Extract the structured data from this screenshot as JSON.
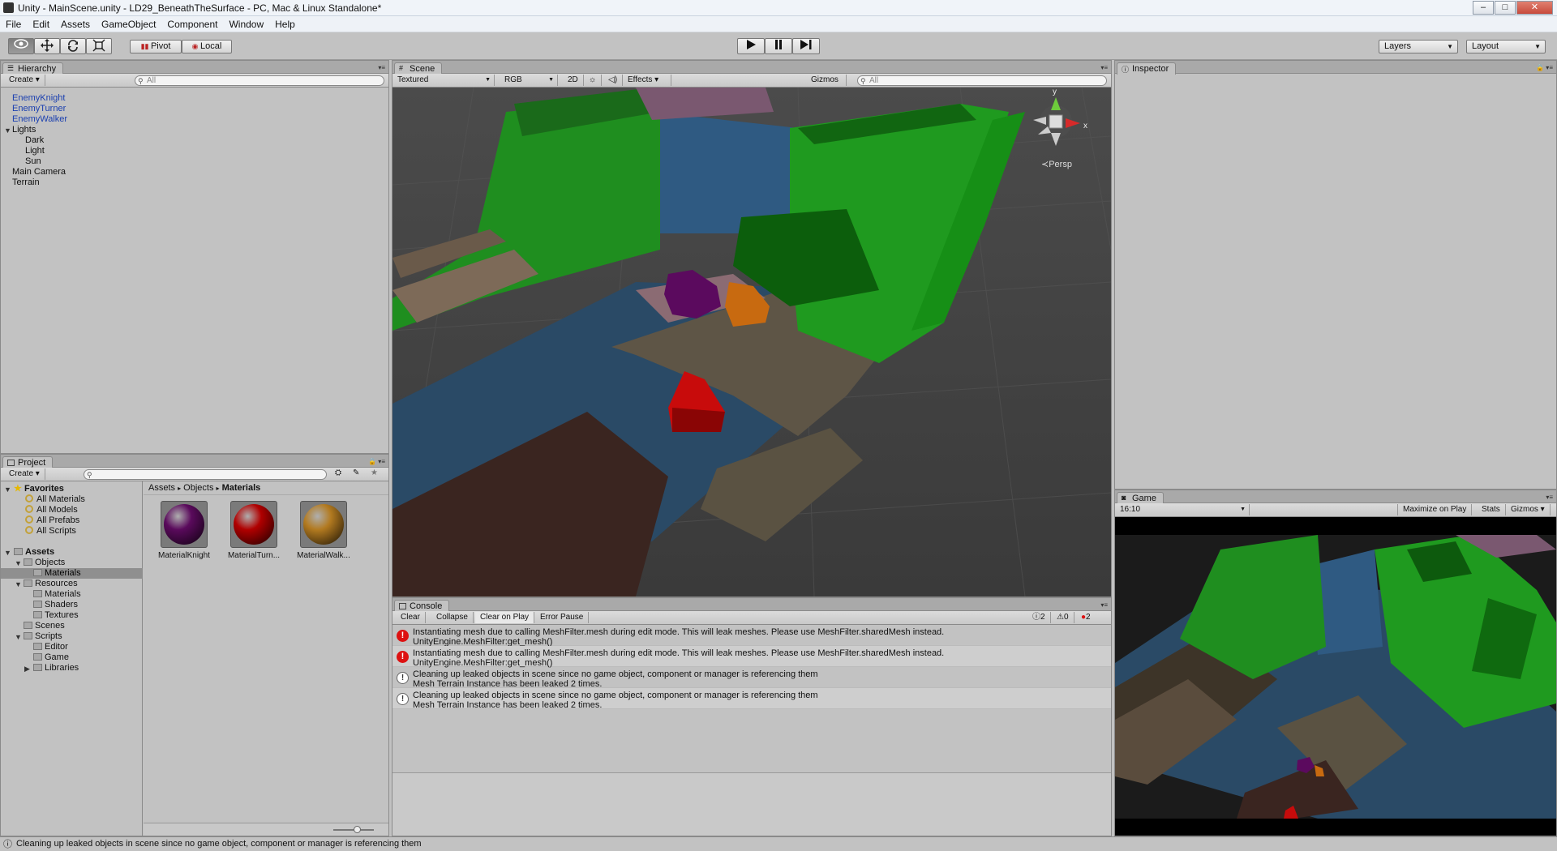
{
  "window": {
    "title": "Unity - MainScene.unity - LD29_BeneathTheSurface - PC, Mac & Linux Standalone*",
    "minimize": "–",
    "maximize": "□",
    "close": "✕",
    "close_color": "#c74b3c"
  },
  "menu": [
    "File",
    "Edit",
    "Assets",
    "GameObject",
    "Component",
    "Window",
    "Help"
  ],
  "toolbar": {
    "tools": [
      "hand-icon",
      "move-icon",
      "rotate-icon",
      "scale-icon"
    ],
    "pivot_label": "Pivot",
    "local_label": "Local",
    "play_icon": "play-icon",
    "pause_icon": "pause-icon",
    "step_icon": "step-icon",
    "layers_label": "Layers",
    "layout_label": "Layout"
  },
  "hierarchy": {
    "tab": "Hierarchy",
    "create_label": "Create",
    "search_placeholder": "All",
    "items": [
      {
        "label": "EnemyKnight",
        "indent": 0,
        "prefab": true
      },
      {
        "label": "EnemyTurner",
        "indent": 0,
        "prefab": true
      },
      {
        "label": "EnemyWalker",
        "indent": 0,
        "prefab": true
      },
      {
        "label": "Lights",
        "indent": 0,
        "expanded": true
      },
      {
        "label": "Dark",
        "indent": 1
      },
      {
        "label": "Light",
        "indent": 1
      },
      {
        "label": "Sun",
        "indent": 1
      },
      {
        "label": "Main Camera",
        "indent": 0
      },
      {
        "label": "Terrain",
        "indent": 0
      }
    ]
  },
  "scene": {
    "tab": "Scene",
    "shading": "Textured",
    "render_mode": "RGB",
    "mode_2d": "2D",
    "effects_label": "Effects",
    "gizmos_label": "Gizmos",
    "search_placeholder": "All",
    "gizmo_y": "y",
    "gizmo_x": "x",
    "persp_label": "Persp"
  },
  "inspector": {
    "tab": "Inspector"
  },
  "project": {
    "tab": "Project",
    "create_label": "Create",
    "breadcrumb": [
      "Assets",
      "Objects",
      "Materials"
    ],
    "favorites": {
      "label": "Favorites",
      "items": [
        "All Materials",
        "All Models",
        "All Prefabs",
        "All Scripts"
      ]
    },
    "assets_label": "Assets",
    "tree": [
      {
        "label": "Objects",
        "level": 1,
        "expanded": true
      },
      {
        "label": "Materials",
        "level": 2,
        "selected": true
      },
      {
        "label": "Resources",
        "level": 1,
        "expanded": true
      },
      {
        "label": "Materials",
        "level": 2
      },
      {
        "label": "Shaders",
        "level": 2
      },
      {
        "label": "Textures",
        "level": 2
      },
      {
        "label": "Scenes",
        "level": 1
      },
      {
        "label": "Scripts",
        "level": 1,
        "expanded": true
      },
      {
        "label": "Editor",
        "level": 2
      },
      {
        "label": "Game",
        "level": 2
      },
      {
        "label": "Libraries",
        "level": 2,
        "collapsed": true
      }
    ],
    "assets": [
      {
        "label": "MaterialKnight",
        "color": "#5a0a5c"
      },
      {
        "label": "MaterialTurn...",
        "color": "#b00000"
      },
      {
        "label": "MaterialWalk...",
        "color": "#b27a20"
      }
    ]
  },
  "console": {
    "tab": "Console",
    "buttons": [
      "Clear",
      "Collapse",
      "Clear on Play",
      "Error Pause"
    ],
    "counts": {
      "info": "2",
      "warnings": "0",
      "errors": "2"
    },
    "messages": [
      {
        "type": "error",
        "line1": "Instantiating mesh due to calling MeshFilter.mesh during edit mode. This will leak meshes. Please use MeshFilter.sharedMesh instead.",
        "line2": "UnityEngine.MeshFilter:get_mesh()"
      },
      {
        "type": "error",
        "line1": "Instantiating mesh due to calling MeshFilter.mesh during edit mode. This will leak meshes. Please use MeshFilter.sharedMesh instead.",
        "line2": "UnityEngine.MeshFilter:get_mesh()"
      },
      {
        "type": "info",
        "line1": "Cleaning up leaked objects in scene since no game object, component or manager is referencing them",
        "line2": " Mesh Terrain Instance has been leaked 2 times."
      },
      {
        "type": "info",
        "line1": "Cleaning up leaked objects in scene since no game object, component or manager is referencing them",
        "line2": " Mesh Terrain Instance has been leaked 2 times."
      }
    ]
  },
  "game": {
    "tab": "Game",
    "aspect": "16:10",
    "maximize_label": "Maximize on Play",
    "stats_label": "Stats",
    "gizmos_label": "Gizmos"
  },
  "status": {
    "message": "Cleaning up leaked objects in scene since no game object, component or manager is referencing them"
  }
}
